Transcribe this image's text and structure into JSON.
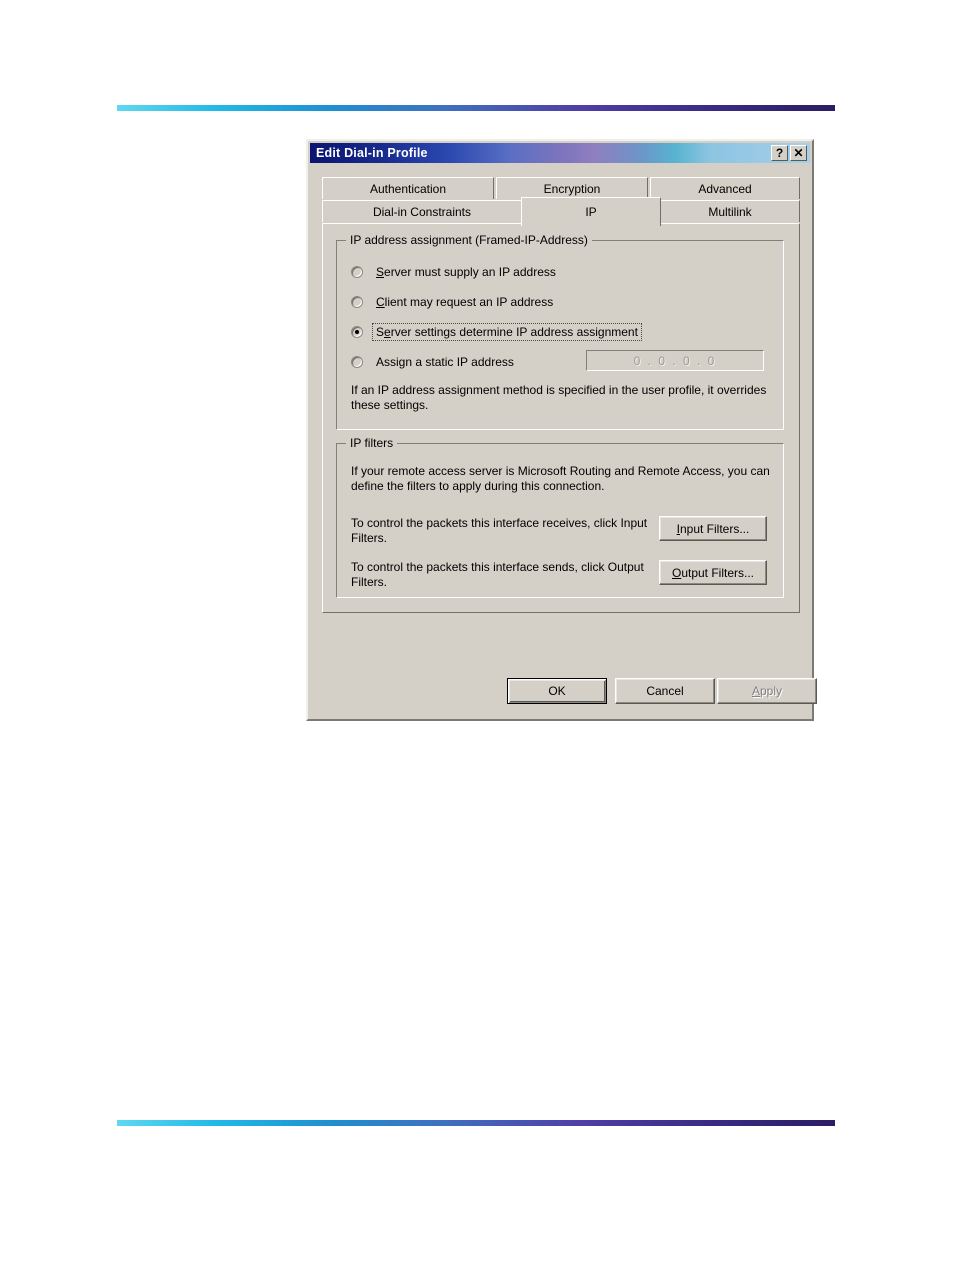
{
  "page": {
    "rule_gradient_start": "#5fd8ef",
    "rule_gradient_end": "#2b1d63"
  },
  "dialog": {
    "title": "Edit Dial-in Profile",
    "titlebar": {
      "help_button": "?",
      "close_button": "✕"
    },
    "tabs": [
      {
        "label": "Authentication",
        "selected": false
      },
      {
        "label": "Encryption",
        "selected": false
      },
      {
        "label": "Advanced",
        "selected": false
      },
      {
        "label": "Dial-in Constraints",
        "selected": false
      },
      {
        "label": "IP",
        "selected": true
      },
      {
        "label": "Multilink",
        "selected": false
      }
    ],
    "ip_assignment_group": {
      "title": "IP address assignment (Framed-IP-Address)",
      "options": [
        {
          "label_prefix": "",
          "accel": "S",
          "label_suffix": "erver must supply an IP address",
          "checked": false,
          "focused": false
        },
        {
          "label_prefix": "",
          "accel": "C",
          "label_suffix": "lient may request an IP address",
          "checked": false,
          "focused": false
        },
        {
          "label_prefix": "S",
          "accel": "e",
          "label_suffix": "rver settings determine IP address assignment",
          "checked": true,
          "focused": true
        },
        {
          "label_prefix": "Assi",
          "accel": "g",
          "label_suffix": "n a static IP address",
          "checked": false,
          "focused": false
        }
      ],
      "static_ip_value": "0 . 0 . 0 . 0",
      "static_ip_enabled": false,
      "note": "If an IP address assignment method is specified in the user profile, it overrides these settings."
    },
    "ip_filters_group": {
      "title": "IP filters",
      "intro": "If your remote access server is Microsoft Routing and Remote Access, you can define the filters to apply during this connection.",
      "rows": [
        {
          "description": "To control the packets this interface receives, click Input Filters.",
          "button_accel": "I",
          "button_suffix": "nput Filters..."
        },
        {
          "description": "To control the packets this interface sends, click Output Filters.",
          "button_accel": "O",
          "button_suffix": "utput Filters..."
        }
      ]
    },
    "footer": {
      "ok_label": "OK",
      "cancel_label": "Cancel",
      "apply_prefix": "",
      "apply_accel": "A",
      "apply_suffix": "pply",
      "apply_enabled": false
    }
  }
}
